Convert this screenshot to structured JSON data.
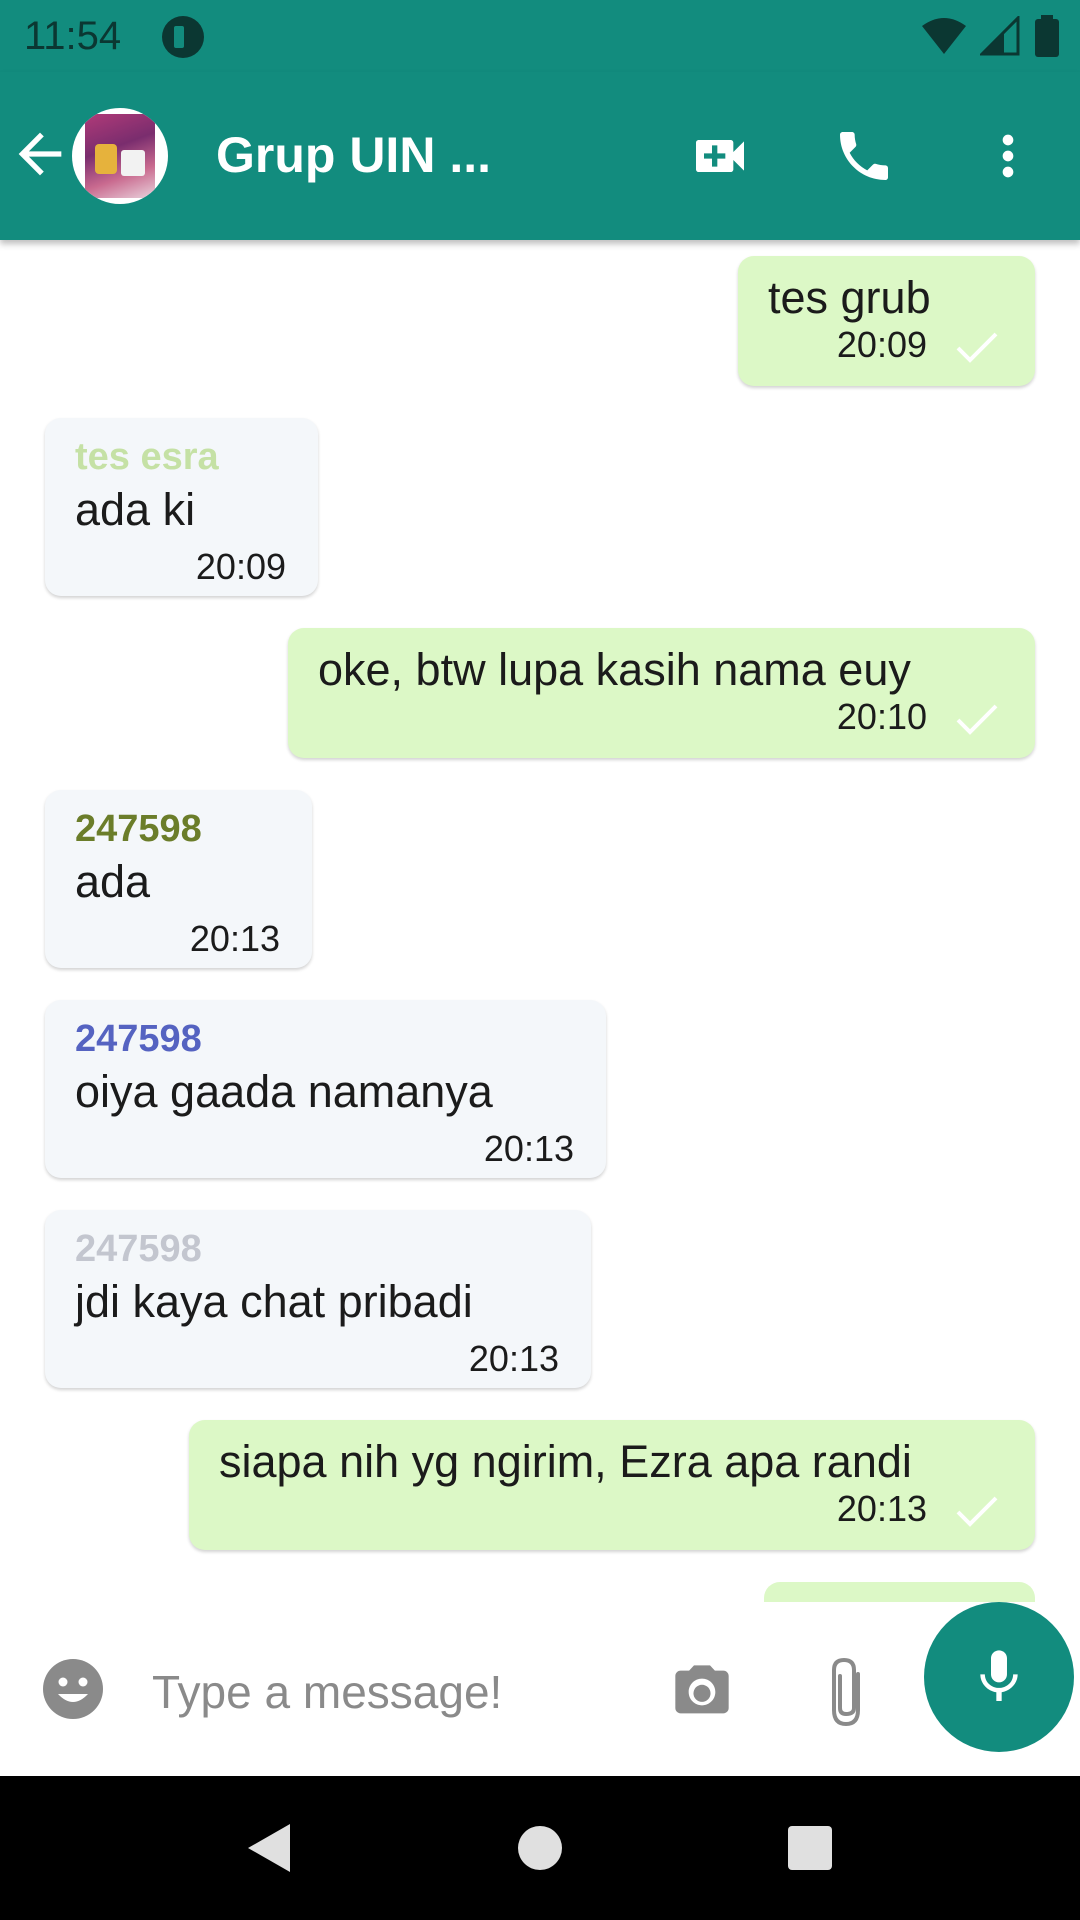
{
  "status_bar": {
    "time": "11:54"
  },
  "header": {
    "title": "Grup UIN ...",
    "icons": [
      "arrow-back-icon",
      "video-call-icon",
      "phone-icon",
      "more-vert-icon"
    ]
  },
  "messages": [
    {
      "direction": "out",
      "text": "tes grub",
      "time": "20:09"
    },
    {
      "direction": "in",
      "sender": "tes esra",
      "sender_color": "#c5e1a5",
      "text": "ada ki",
      "time": "20:09"
    },
    {
      "direction": "out",
      "text": "oke, btw lupa kasih nama euy",
      "time": "20:10"
    },
    {
      "direction": "in",
      "sender": "247598",
      "sender_color": "#6b7d2a",
      "text": "ada",
      "time": "20:13"
    },
    {
      "direction": "in",
      "sender": "247598",
      "sender_color": "#5563c1",
      "text": "oiya gaada namanya",
      "time": "20:13"
    },
    {
      "direction": "in",
      "sender": "247598",
      "sender_color": "#c3c6cf",
      "text": "jdi kaya chat pribadi",
      "time": "20:13"
    },
    {
      "direction": "out",
      "text": "siapa nih yg ngirim, Ezra apa randi",
      "time": "20:13"
    }
  ],
  "composer": {
    "placeholder": "Type a message!"
  },
  "colors": {
    "primary": "#128c7e",
    "outgoing_bubble": "#dcf8c6",
    "incoming_bubble": "#f4f7fa"
  }
}
